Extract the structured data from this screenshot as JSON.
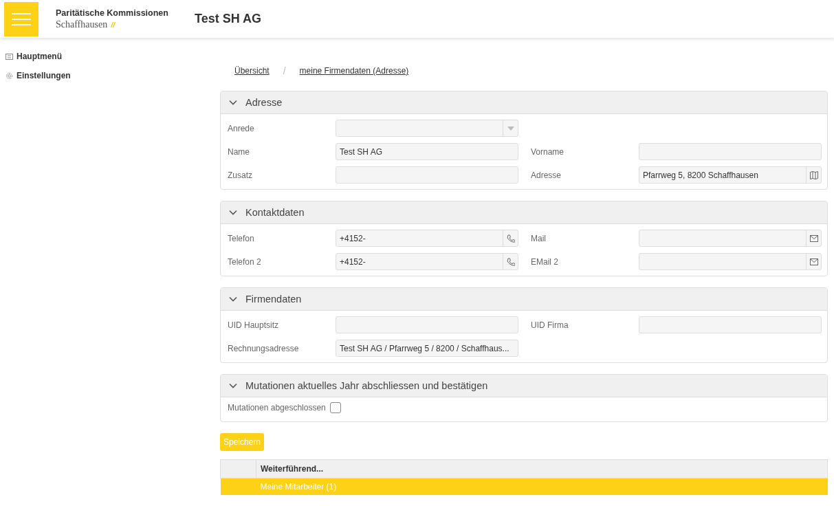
{
  "header": {
    "logo_line1": "Paritätische Kommissionen",
    "logo_line2": "Schaffhausen",
    "logo_mark": "//",
    "title": "Test SH AG"
  },
  "sidebar": {
    "items": [
      {
        "label": "Hauptmenü",
        "kind": "menu"
      },
      {
        "label": "Einstellungen",
        "kind": "gear"
      }
    ]
  },
  "breadcrumb": {
    "items": [
      "Übersicht",
      "meine Firmendaten (Adresse)"
    ],
    "separator": "/"
  },
  "sections": [
    {
      "title": "Adresse",
      "expanded": true,
      "rows": [
        [
          {
            "label": "Anrede",
            "kind": "select"
          }
        ],
        [
          {
            "label": "Name",
            "kind": "text",
            "value": "Test SH AG"
          },
          {
            "label": "Vorname",
            "kind": "text"
          }
        ],
        [
          {
            "label": "Zusatz",
            "kind": "text"
          },
          {
            "label": "Adresse",
            "kind": "map",
            "value": "Pfarrweg 5, 8200 Schaffhausen"
          }
        ]
      ]
    },
    {
      "title": "Kontaktdaten",
      "expanded": true,
      "rows": [
        [
          {
            "label": "Telefon",
            "kind": "phone",
            "value": "+4152-"
          },
          {
            "label": "Mail",
            "kind": "mail"
          }
        ],
        [
          {
            "label": "Telefon 2",
            "kind": "phone",
            "value": "+4152-"
          },
          {
            "label": "EMail 2",
            "kind": "mail"
          }
        ]
      ]
    },
    {
      "title": "Firmendaten",
      "expanded": true,
      "rows": [
        [
          {
            "label": "UID Hauptsitz",
            "kind": "text"
          },
          {
            "label": "UID Firma",
            "kind": "text"
          }
        ],
        [
          {
            "label": "Rechnungsadresse",
            "kind": "text",
            "value": "Test SH AG / Pfarrweg 5 / 8200 / Schaffhaus..."
          }
        ]
      ]
    },
    {
      "title": "Mutationen aktuelles Jahr abschliessen und bestätigen",
      "expanded": true,
      "rows": [
        [
          {
            "label": "Mutationen abgeschlossen",
            "kind": "checkbox",
            "checked": false
          }
        ]
      ]
    }
  ],
  "save_button": "Speichern",
  "table": {
    "columns": [
      "Weiterführend..."
    ],
    "rows": [
      {
        "label": "Meine Mitarbeiter (1)",
        "selected": true
      }
    ]
  }
}
